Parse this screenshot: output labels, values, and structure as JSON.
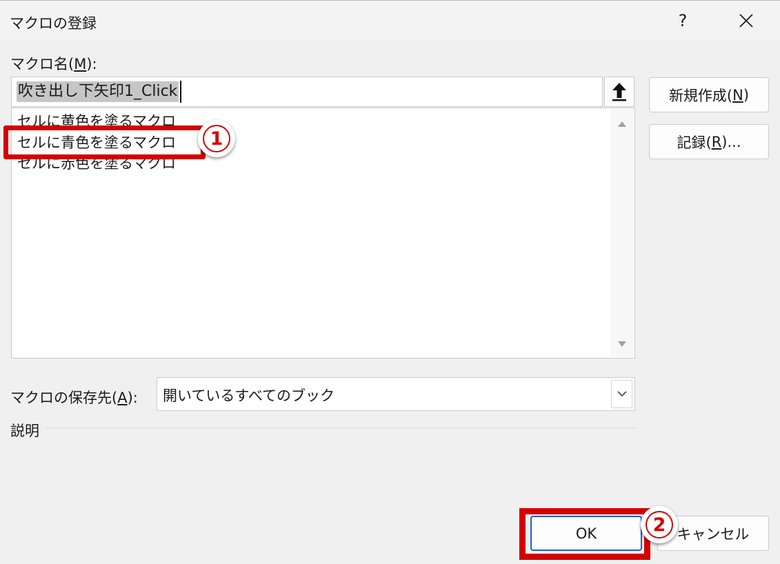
{
  "window": {
    "title": "マクロの登録",
    "help_label": "?",
    "close_icon": "close-icon"
  },
  "macro_name": {
    "label_prefix": "マクロ名(",
    "label_key": "M",
    "label_suffix": "):",
    "value": "吹き出し下矢印1_Click",
    "up_button_icon": "arrow-up-icon"
  },
  "macro_list": {
    "items": [
      "セルに黄色を塗るマクロ",
      "セルに青色を塗るマクロ",
      "セルに赤色を塗るマクロ"
    ],
    "highlighted_index": 1
  },
  "buttons": {
    "new_prefix": "新規作成(",
    "new_key": "N",
    "new_suffix": ")",
    "record_prefix": "記録(",
    "record_key": "R",
    "record_suffix": ")...",
    "ok": "OK",
    "cancel": "キャンセル"
  },
  "save_location": {
    "label_prefix": "マクロの保存先(",
    "label_key": "A",
    "label_suffix": "):",
    "value": "開いているすべてのブック"
  },
  "description": {
    "label": "説明"
  },
  "annotations": {
    "step1": "1",
    "step2": "2",
    "highlight_color": "#d40000"
  }
}
